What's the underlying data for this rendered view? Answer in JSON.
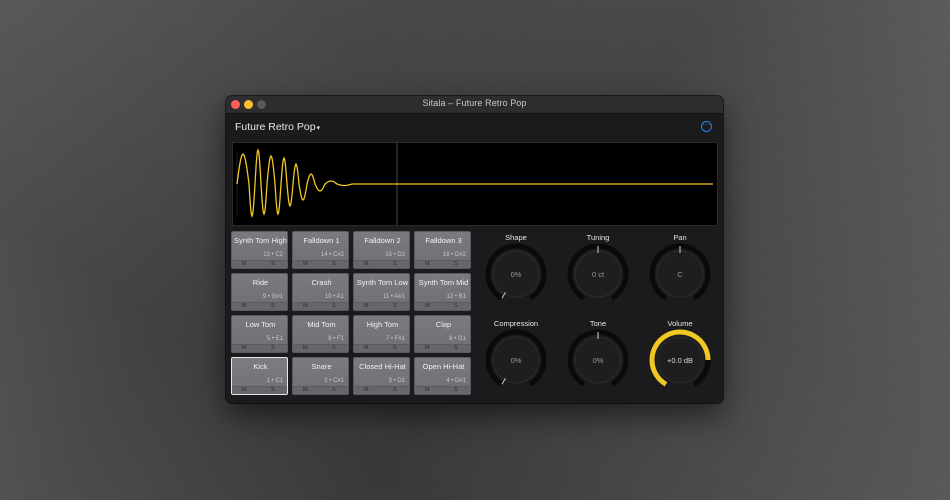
{
  "window": {
    "title": "Sitala – Future Retro Pop"
  },
  "header": {
    "preset_name": "Future Retro Pop",
    "preset_caret": "▾",
    "more_glyph": "···"
  },
  "pads": [
    {
      "name": "Synth Tom High",
      "note": "13 • C2",
      "mute": "M",
      "solo": "S"
    },
    {
      "name": "Falldown 1",
      "note": "14 • C#2",
      "mute": "M",
      "solo": "S"
    },
    {
      "name": "Falldown 2",
      "note": "15 • D2",
      "mute": "M",
      "solo": "S"
    },
    {
      "name": "Falldown 3",
      "note": "16 • D#2",
      "mute": "M",
      "solo": "S"
    },
    {
      "name": "Ride",
      "note": "9 • G#1",
      "mute": "M",
      "solo": "S"
    },
    {
      "name": "Crash",
      "note": "10 • A1",
      "mute": "M",
      "solo": "S"
    },
    {
      "name": "Synth Tom Low",
      "note": "11 • A#1",
      "mute": "M",
      "solo": "S"
    },
    {
      "name": "Synth Tom Mid",
      "note": "12 • B1",
      "mute": "M",
      "solo": "S"
    },
    {
      "name": "Low Tom",
      "note": "5 • E1",
      "mute": "M",
      "solo": "S"
    },
    {
      "name": "Mid Tom",
      "note": "6 • F1",
      "mute": "M",
      "solo": "S"
    },
    {
      "name": "High Tom",
      "note": "7 • F#1",
      "mute": "M",
      "solo": "S"
    },
    {
      "name": "Clap",
      "note": "8 • G1",
      "mute": "M",
      "solo": "S"
    },
    {
      "name": "Kick",
      "note": "1 • C1",
      "mute": "M",
      "solo": "S"
    },
    {
      "name": "Snare",
      "note": "2 • C#1",
      "mute": "M",
      "solo": "S"
    },
    {
      "name": "Closed Hi-Hat",
      "note": "3 • D1",
      "mute": "M",
      "solo": "S"
    },
    {
      "name": "Open Hi-Hat",
      "note": "4 • D#1",
      "mute": "M",
      "solo": "S"
    }
  ],
  "selected_pad": "Kick",
  "knobs": [
    {
      "label": "Shape",
      "value": "0%",
      "level": 0.0
    },
    {
      "label": "Tuning",
      "value": "0 ct",
      "level": 0.5
    },
    {
      "label": "Pan",
      "value": "C",
      "level": 0.5
    },
    {
      "label": "Compression",
      "value": "0%",
      "level": 0.0
    },
    {
      "label": "Tone",
      "value": "0%",
      "level": 0.5
    },
    {
      "label": "Volume",
      "value": "+0.0 dB",
      "level": 0.8
    }
  ],
  "colors": {
    "accent": "#f2c623",
    "waveform": "#f2c623",
    "link_blue": "#2b86f0",
    "pad": "#747479",
    "window_bg": "#1b1b1d"
  },
  "icons": {
    "more": "ellipsis-circle-icon",
    "preset_dropdown": "chevron-down-icon"
  }
}
